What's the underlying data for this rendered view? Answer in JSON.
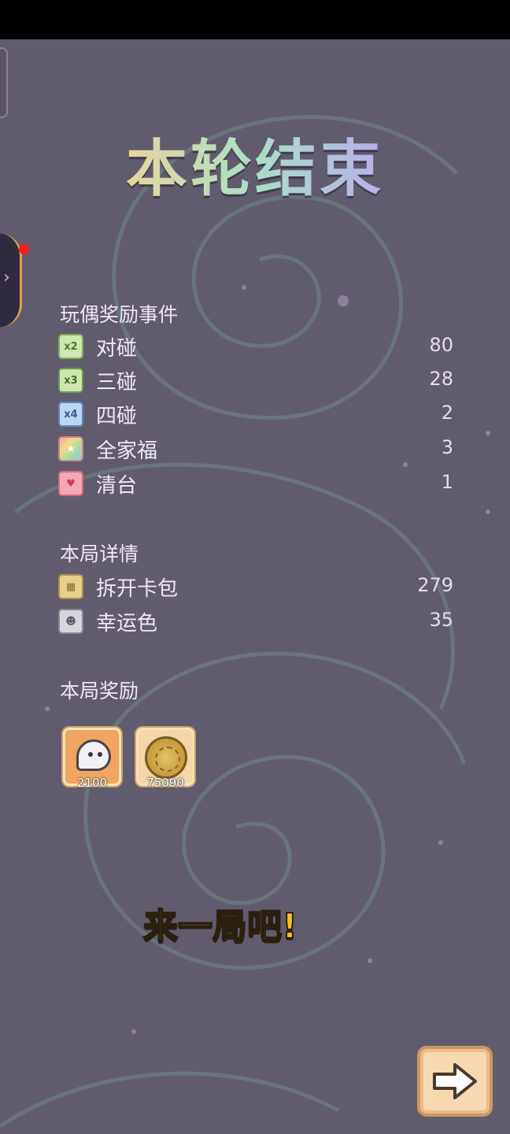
{
  "title": "本轮结束",
  "events": {
    "header": "玩偶奖励事件",
    "items": [
      {
        "icon": "x2-badge-icon",
        "badge": "x2",
        "label": "对碰",
        "value": "80"
      },
      {
        "icon": "x3-badge-icon",
        "badge": "x3",
        "label": "三碰",
        "value": "28"
      },
      {
        "icon": "x4-badge-icon",
        "badge": "x4",
        "label": "四碰",
        "value": "2"
      },
      {
        "icon": "rainbow-star-icon",
        "badge": "★",
        "label": "全家福",
        "value": "3"
      },
      {
        "icon": "heart-icon",
        "badge": "♥",
        "label": "清台",
        "value": "1"
      }
    ]
  },
  "details": {
    "header": "本局详情",
    "items": [
      {
        "icon": "card-pack-icon",
        "badge": "▦",
        "label": "拆开卡包",
        "value": "279"
      },
      {
        "icon": "lucky-dice-icon",
        "badge": "☻",
        "label": "幸运色",
        "value": "35"
      }
    ]
  },
  "rewards": {
    "header": "本局奖励",
    "items": [
      {
        "icon": "ghost-icon",
        "amount": "2100"
      },
      {
        "icon": "gold-coin-icon",
        "amount": "75090"
      }
    ]
  },
  "cta": "来一局吧!",
  "colors": {
    "background": "#615b6e",
    "cta_text": "#f6c218",
    "next_button": "#f6d9b2"
  }
}
